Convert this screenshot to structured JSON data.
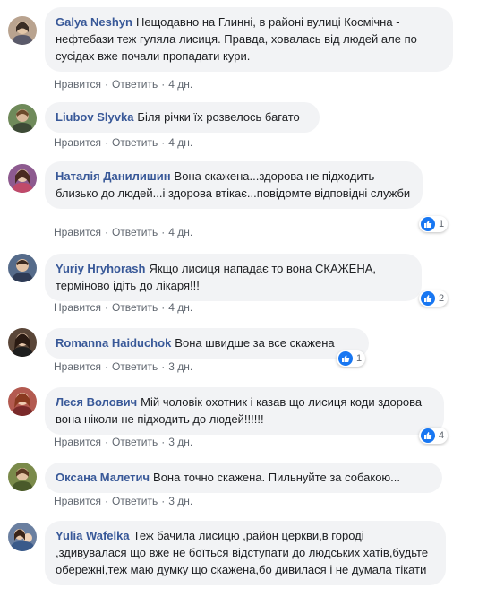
{
  "comments": [
    {
      "author": "Galya Neshyn",
      "text": "Нещодавно на Глинні, в районі вулиці Космічна - нефтебази теж гуляла лисиця. Правда, ховалась від людей але по сусідах вже почали пропадати кури.",
      "like": "Нравится",
      "reply": "Ответить",
      "time": "4 дн.",
      "avatar_color": "#b9a38f"
    },
    {
      "author": "Liubov Slyvka",
      "text": "Біля річки їх розвелось багато",
      "like": "Нравится",
      "reply": "Ответить",
      "time": "4 дн.",
      "avatar_color": "#6f8a5a"
    },
    {
      "author": "Наталія Данилишин",
      "text": "Вона скажена...здорова не підходить близько до людей...і здорова втікає...повідомте відповідні служби",
      "like": "Нравится",
      "reply": "Ответить",
      "time": "4 дн.",
      "reactions": "1",
      "avatar_color": "#8d5a8f"
    },
    {
      "author": "Yuriy Hryhorash",
      "text": "Якщо лисиця нападає то вона СКАЖЕНА, терміново ідіть до лікаря!!!",
      "like": "Нравится",
      "reply": "Ответить",
      "time": "4 дн.",
      "reactions": "2",
      "avatar_color": "#556b8a"
    },
    {
      "author": "Romanna Haiduchok",
      "text": "Вона швидше за все скажена",
      "like": "Нравится",
      "reply": "Ответить",
      "time": "3 дн.",
      "reactions": "1",
      "avatar_color": "#5a4638"
    },
    {
      "author": "Леся Волович",
      "text": "Мій чоловік охотник і казав що лисиця коди здорова вона ніколи не підходить до людей!!!!!!",
      "like": "Нравится",
      "reply": "Ответить",
      "time": "3 дн.",
      "reactions": "4",
      "avatar_color": "#b35a50"
    },
    {
      "author": "Оксана Малетич",
      "text": "Вона точно скажена. Пильнуйте за собакою...",
      "like": "Нравится",
      "reply": "Ответить",
      "time": "3 дн.",
      "avatar_color": "#7a8a4a"
    },
    {
      "author": "Yulia Wafelka",
      "text": "Теж бачила лисицю ,район церкви,в городі ,здивувалася що вже не боїться відступати до людських хатів,будьте обережні,теж маю думку що скажена,бо дивилася і не думала тікати",
      "avatar_color": "#6a7fa0"
    }
  ]
}
